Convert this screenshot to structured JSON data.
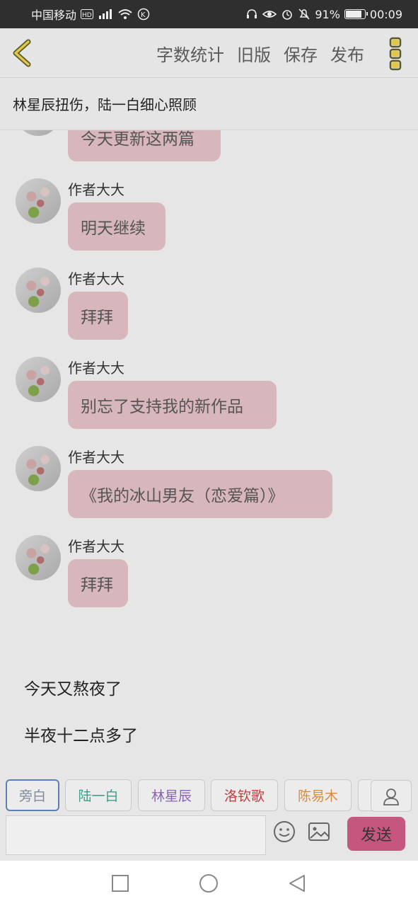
{
  "status_bar": {
    "carrier": "中国移动",
    "battery_percent": "91%",
    "time": "00:09",
    "battery_level": 0.91
  },
  "toolbar": {
    "actions": [
      "字数统计",
      "旧版",
      "保存",
      "发布"
    ]
  },
  "chapter_title": "林星辰扭伤，陆一白细心照顾",
  "messages": [
    {
      "author": "",
      "text": "今天更新这两篇"
    },
    {
      "author": "作者大大",
      "text": "明天继续"
    },
    {
      "author": "作者大大",
      "text": "拜拜"
    },
    {
      "author": "作者大大",
      "text": "别忘了支持我的新作品"
    },
    {
      "author": "作者大大",
      "text": "《我的冰山男友（恋爱篇）》"
    },
    {
      "author": "作者大大",
      "text": "拜拜"
    }
  ],
  "narration": [
    "今天又熬夜了",
    "半夜十二点多了"
  ],
  "roles": [
    {
      "label": "旁白",
      "color": "#7f8a9a"
    },
    {
      "label": "陆一白",
      "color": "#3aa08a"
    },
    {
      "label": "林星辰",
      "color": "#8a63b8"
    },
    {
      "label": "洛钦歌",
      "color": "#c53a3a"
    },
    {
      "label": "陈易木",
      "color": "#d98a3d"
    }
  ],
  "send_label": "发送",
  "colors": {
    "accent_send": "#c5577e",
    "bubble": "#d7b6bc",
    "icon_yellow": "#e2c84a"
  },
  "icons": [
    "back-arrow-icon",
    "more-menu-icon",
    "emoji-icon",
    "image-icon",
    "person-icon",
    "square-nav-icon",
    "circle-nav-icon",
    "triangle-back-icon"
  ]
}
